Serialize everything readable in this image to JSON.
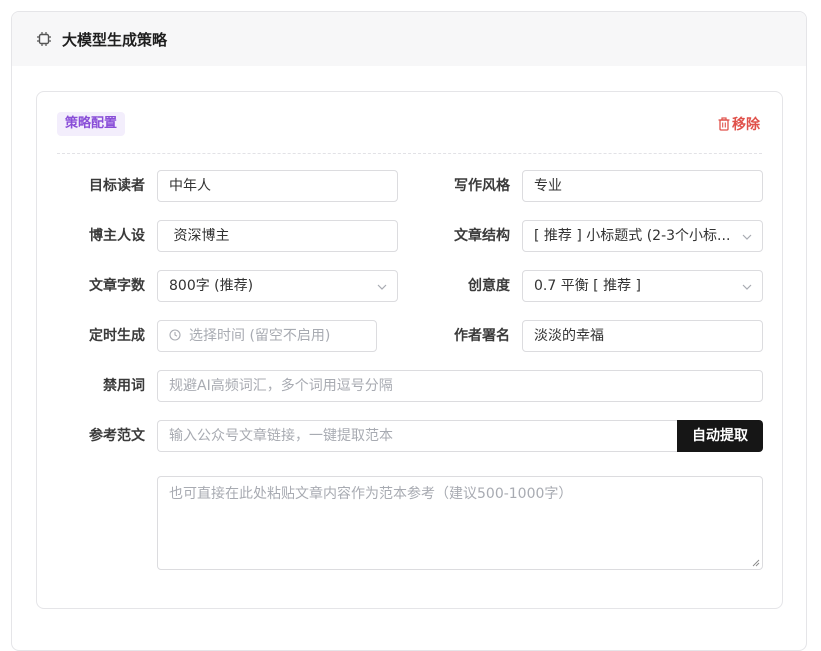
{
  "section": {
    "title": "大模型生成策略",
    "icon": "chip-icon"
  },
  "card": {
    "tag": "策略配置",
    "remove_label": "移除",
    "colors": {
      "tag_bg": "#f3eefc",
      "tag_text": "#8a4fd8",
      "remove": "#e0524b",
      "button": "#161616"
    }
  },
  "form": {
    "target_reader": {
      "label": "目标读者",
      "value": "中年人"
    },
    "writing_style": {
      "label": "写作风格",
      "value": "专业"
    },
    "blogger_persona": {
      "label": "博主人设",
      "value": " 资深博主"
    },
    "article_structure": {
      "label": "文章结构",
      "value": "[ 推荐 ] 小标题式 (2-3个小标..."
    },
    "word_count": {
      "label": "文章字数",
      "value": "800字 (推荐)"
    },
    "creativity": {
      "label": "创意度",
      "value": "0.7 平衡 [ 推荐 ]"
    },
    "scheduled": {
      "label": "定时生成",
      "placeholder": "选择时间 (留空不启用)"
    },
    "author_signature": {
      "label": "作者署名",
      "value": "淡淡的幸福"
    },
    "banned_words": {
      "label": "禁用词",
      "placeholder": "规避AI高频词汇，多个词用逗号分隔"
    },
    "reference": {
      "label": "参考范文",
      "url_placeholder": "输入公众号文章链接，一键提取范本",
      "fetch_button": "自动提取",
      "text_placeholder": "也可直接在此处粘贴文章内容作为范本参考（建议500-1000字）"
    }
  }
}
